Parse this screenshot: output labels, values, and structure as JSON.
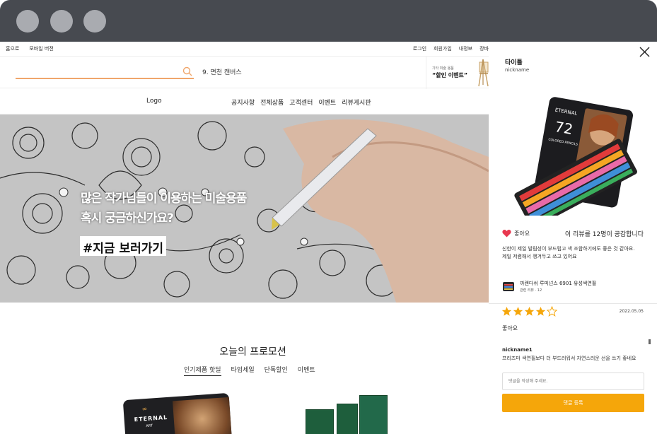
{
  "topbar": {
    "left": [
      "홈으로",
      "모바일 버전"
    ],
    "right": [
      "로그인",
      "회원가입",
      "내정보",
      "장바"
    ]
  },
  "search": {
    "placeholder": "",
    "keyword": "9. 면천 캔버스"
  },
  "promo_box": {
    "small": "기타 미술 용품",
    "big": "“할인 이벤트”"
  },
  "nav": {
    "logo": "Logo",
    "items": [
      "공지사항",
      "전체상품",
      "고객센터",
      "이벤트",
      "리뷰게시판"
    ]
  },
  "hero": {
    "line1": "많은 작가님들이 이용하는 미술용품",
    "line2": "혹시 궁금하신가요?",
    "cta": "#지금 보러가기"
  },
  "promotion": {
    "title": "오늘의 프로모션",
    "tabs": [
      "인기제품 핫딜",
      "타임세일",
      "단독할인",
      "이벤트"
    ],
    "product1_brand": "ETERNAL",
    "product1_sub": "ART"
  },
  "review_panel": {
    "title": "타이틀",
    "nickname": "nickname",
    "box_number": "72",
    "box_brand": "ETERNAL",
    "box_label": "COLORED PENCILS",
    "like_label": "좋아요",
    "like_count_text": "이 리뷰를 12명이 공감합니다",
    "review_text": "신한이 제일 발림성이 부드럽고 색 조합하기에도 좋은 것 같아요. 제일 저렴해서 쟁겨두고 쓰고 있어요",
    "product_name": "까렌다쉬 루미넌스 6901 유성색연필",
    "product_review_count": "관련 리뷰 · 12",
    "rating": 4,
    "rating_max": 5,
    "review_date": "2022.05.05",
    "rating_text": "좋아요",
    "comment_nick": "nickname1",
    "comment_text": "프리즈마 색연필보다 더 부드러워서 자연스러운 선을 쓰기 좋네요",
    "comment_placeholder": "댓글을 작성해 주세요.",
    "submit_label": "댓글 등록"
  },
  "colors": {
    "accent": "#f5a60a",
    "search_underline": "#f0a66b",
    "heart": "#e8384f",
    "titlebar": "#474a50"
  }
}
